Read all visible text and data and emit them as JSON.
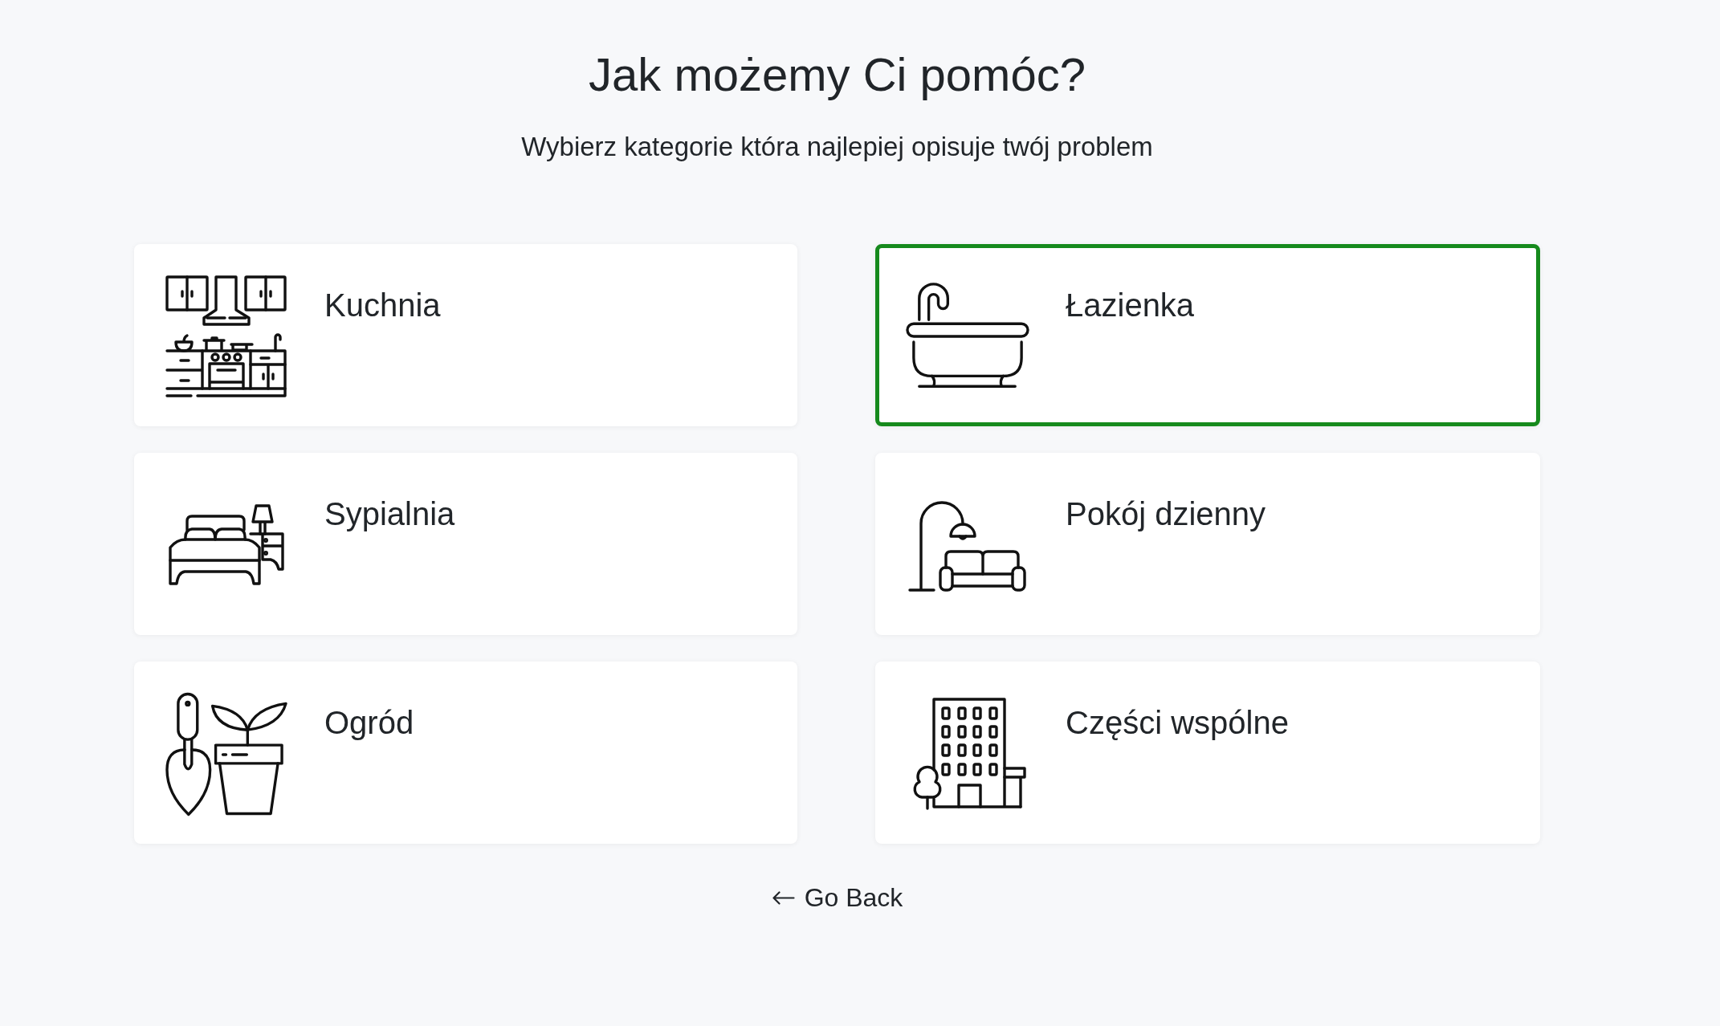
{
  "heading": "Jak możemy Ci pomóc?",
  "subheading": "Wybierz kategorie która najlepiej opisuje twój problem",
  "categories": [
    {
      "label": "Kuchnia",
      "selected": false
    },
    {
      "label": "Łazienka",
      "selected": true
    },
    {
      "label": "Sypialnia",
      "selected": false
    },
    {
      "label": "Pokój dzienny",
      "selected": false
    },
    {
      "label": "Ogród",
      "selected": false
    },
    {
      "label": "Części wspólne",
      "selected": false
    }
  ],
  "back_link": {
    "label": "Go Back"
  }
}
